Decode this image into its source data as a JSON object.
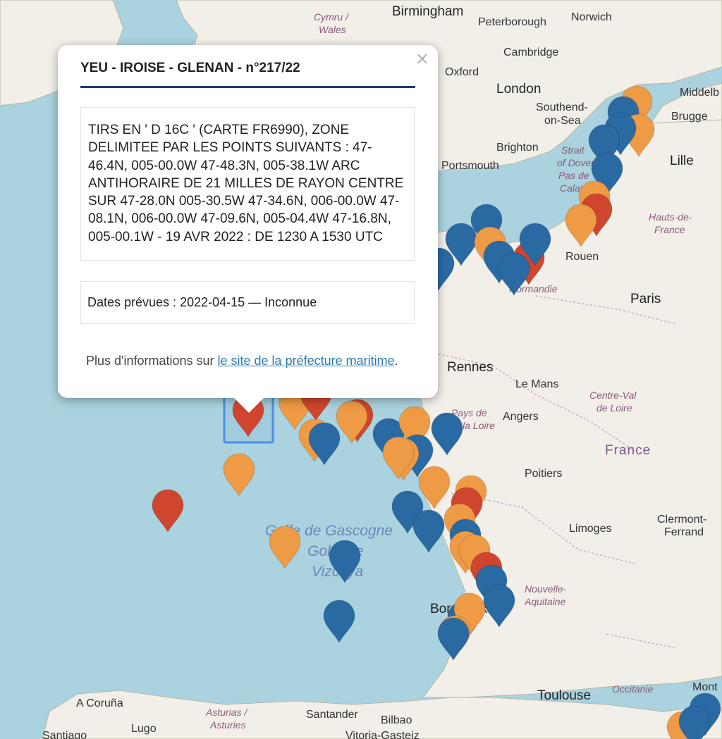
{
  "popup": {
    "title": "YEU - IROISE - GLENAN - n°217/22",
    "close_glyph": "×",
    "description": "TIRS EN ' D 16C ' (CARTE FR6990), ZONE DELIMITEE PAR LES POINTS SUIVANTS : 47-46.4N, 005-00.0W 47-48.3N, 005-38.1W ARC ANTIHORAIRE DE 21 MILLES DE RAYON CENTRE SUR 47-28.0N 005-30.5W 47-34.6N, 006-00.0W 47-08.1N, 006-00.0W 47-09.6N, 005-04.4W 47-16.8N, 005-00.1W - 19 AVR 2022 : DE 1230 A 1530 UTC",
    "dates_label": "Dates prévues : 2022-04-15 — Inconnue",
    "more_prefix": "Plus d'informations sur ",
    "more_link": "le site de la préfecture maritime",
    "more_suffix": "."
  },
  "map": {
    "place_labels": {
      "birmingham": "Birmingham",
      "peterborough": "Peterborough",
      "norwich": "Norwich",
      "cymru": "Cymru /",
      "wales": "Wales",
      "cambridge": "Cambridge",
      "oxford": "Oxford",
      "london": "London",
      "southend1": "Southend-",
      "southend2": "on-Sea",
      "middelburg": "Middelb",
      "brugge": "Brugge",
      "brighton": "Brighton",
      "portsmouth": "Portsmouth",
      "strait1": "Strait",
      "strait2": "of Dover",
      "strait3": "Pas de",
      "strait4": "Calais",
      "lille": "Lille",
      "hdf1": "Hauts-de-",
      "hdf2": "France",
      "rouen": "Rouen",
      "normandie": "Normandie",
      "paris": "Paris",
      "rennes": "Rennes",
      "lemans": "Le Mans",
      "cvl1": "Centre-Val",
      "cvl2": "de Loire",
      "pdl1": "Pays de",
      "pdl2": "la Loire",
      "angers": "Angers",
      "france": "France",
      "poitiers": "Poitiers",
      "limoges": "Limoges",
      "clermont1": "Clermont-",
      "clermont2": "Ferrand",
      "golfe1": "Golfe de Gascogne",
      "golfe2": "Golfo de",
      "golfe3": "Vizcaya",
      "na1": "Nouvelle-",
      "na2": "Aquitaine",
      "bordeaux": "Bordeaux",
      "toulouse": "Toulouse",
      "occitanie": "Occitanie",
      "montpellier": "Mont",
      "coruna": "A Coruña",
      "lugo": "Lugo",
      "asturias1": "Asturias /",
      "asturias2": "Asturies",
      "santander": "Santander",
      "bilbao": "Bilbao",
      "vitoria": "Vitoria-Gasteiz",
      "santiago": "Santiago"
    },
    "marker_colors": {
      "blue": "#2a6aa3",
      "orange": "#ef9a45",
      "red": "#d0452e"
    },
    "selected_marker": "red"
  }
}
